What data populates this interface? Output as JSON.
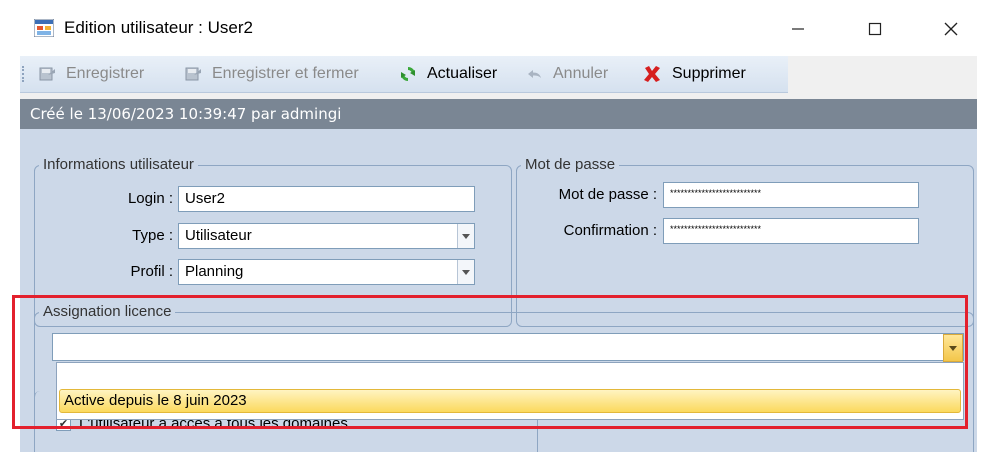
{
  "window": {
    "title": "Edition utilisateur : User2",
    "minimize_icon": "minimize-icon",
    "maximize_icon": "maximize-icon",
    "close_icon": "close-icon"
  },
  "toolbar": {
    "items": [
      {
        "label": "Enregistrer",
        "icon": "save-icon",
        "enabled": false
      },
      {
        "label": "Enregistrer et fermer",
        "icon": "save-close-icon",
        "enabled": false
      },
      {
        "label": "Actualiser",
        "icon": "refresh-icon",
        "enabled": true
      },
      {
        "label": "Annuler",
        "icon": "undo-icon",
        "enabled": false
      },
      {
        "label": "Supprimer",
        "icon": "delete-icon",
        "enabled": true
      }
    ]
  },
  "created_info": "Créé le 13/06/2023 10:39:47 par admingi",
  "user_info": {
    "legend": "Informations utilisateur",
    "login_label": "Login :",
    "login_value": "User2",
    "type_label": "Type :",
    "type_value": "Utilisateur",
    "profil_label": "Profil :",
    "profil_value": "Planning"
  },
  "password": {
    "legend": "Mot de passe",
    "password_label": "Mot de passe :",
    "password_value": "**************************",
    "confirm_label": "Confirmation :",
    "confirm_value": "**************************"
  },
  "license": {
    "legend": "Assignation licence",
    "selected_value": "",
    "options": [
      "Active depuis le 8 juin 2023"
    ]
  },
  "domains_checkbox": {
    "label": "L'utilisateur a accès à tous les domaines",
    "checked": true
  },
  "colors": {
    "highlight_border": "#e3202d",
    "form_background": "#ccd8e8",
    "info_bar": "#7a8694",
    "selected_item": "#fbd95e"
  }
}
